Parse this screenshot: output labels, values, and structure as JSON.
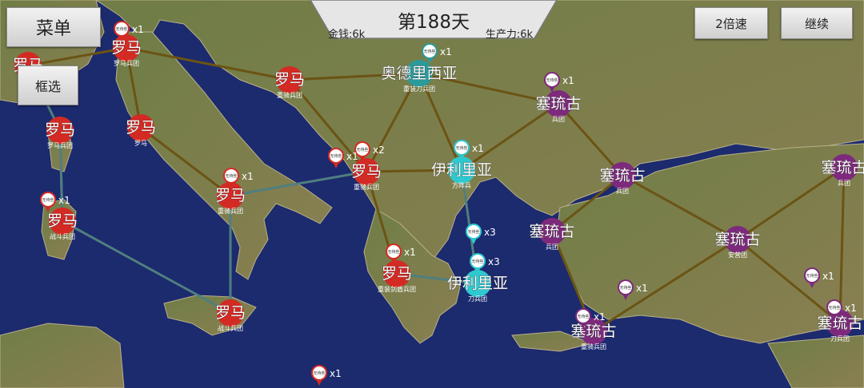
{
  "ui": {
    "menu_label": "菜单",
    "select_label": "框选",
    "day_label": "第188天",
    "money_label": "金钱:6k",
    "production_label": "生产力:6k",
    "speed_label": "2倍速",
    "continue_label": "继续"
  },
  "factions": {
    "rome": {
      "name": "罗马",
      "color": "#d42a24"
    },
    "illyria": {
      "name": "伊利里亚",
      "color": "#2ec8cf"
    },
    "sarmatia": {
      "name": "塞琉古",
      "color": "#7d2a7c"
    },
    "odrysia": {
      "name": "奥德里西亚",
      "color": "#2a9a9a"
    }
  },
  "nodes": [
    {
      "id": "rome-nw1",
      "faction": "rome",
      "name": "罗马",
      "sub": ""
    },
    {
      "id": "rome-n",
      "faction": "rome",
      "name": "罗马",
      "sub": "罗马兵团"
    },
    {
      "id": "rome-venice",
      "faction": "rome",
      "name": "罗马",
      "sub": "重骑兵团"
    },
    {
      "id": "rome-corsica",
      "faction": "rome",
      "name": "罗马",
      "sub": "罗马兵团"
    },
    {
      "id": "rome-center",
      "faction": "rome",
      "name": "罗马",
      "sub": "罗马"
    },
    {
      "id": "rome-naples",
      "faction": "rome",
      "name": "罗马",
      "sub": "重骑兵团"
    },
    {
      "id": "rome-sardinia",
      "faction": "rome",
      "name": "罗马",
      "sub": "战斗兵团"
    },
    {
      "id": "rome-albania",
      "faction": "rome",
      "name": "罗马",
      "sub": "重骑兵团"
    },
    {
      "id": "rome-greece",
      "faction": "rome",
      "name": "罗马",
      "sub": "重装剑盾兵团"
    },
    {
      "id": "rome-sicily",
      "faction": "rome",
      "name": "罗马",
      "sub": "战斗兵团"
    },
    {
      "id": "odrysia-main",
      "faction": "odrysia",
      "name": "奥德里西亚",
      "sub": "重装刀兵团"
    },
    {
      "id": "illyria-north",
      "faction": "illyria",
      "name": "伊利里亚",
      "sub": "方阵兵"
    },
    {
      "id": "illyria-south",
      "faction": "illyria",
      "name": "伊利里亚",
      "sub": "刀兵团"
    },
    {
      "id": "sel-thrace",
      "faction": "sarmatia",
      "name": "塞琉古",
      "sub": "兵团"
    },
    {
      "id": "sel-bosporus",
      "faction": "sarmatia",
      "name": "塞琉古",
      "sub": "兵团"
    },
    {
      "id": "sel-east",
      "faction": "sarmatia",
      "name": "塞琉古",
      "sub": "兵团"
    },
    {
      "id": "sel-ionia",
      "faction": "sarmatia",
      "name": "塞琉古",
      "sub": "兵团"
    },
    {
      "id": "sel-anatolia",
      "faction": "sarmatia",
      "name": "塞琉古",
      "sub": "安营团"
    },
    {
      "id": "sel-rhodes",
      "faction": "sarmatia",
      "name": "塞琉古",
      "sub": "重骑兵团"
    },
    {
      "id": "sel-syria",
      "faction": "sarmatia",
      "name": "塞琉古",
      "sub": "刀兵团"
    }
  ],
  "armies": [
    {
      "id": "a1",
      "label": "无待些",
      "count": "x1",
      "faction": "rome"
    },
    {
      "id": "a2",
      "label": "无待些",
      "count": "x1",
      "faction": "rome"
    },
    {
      "id": "a3",
      "label": "无待些",
      "count": "x1",
      "faction": "rome"
    },
    {
      "id": "a4",
      "label": "无待些",
      "count": "x2",
      "faction": "rome"
    },
    {
      "id": "a5",
      "label": "无待些",
      "count": "x1",
      "faction": "rome"
    },
    {
      "id": "a6",
      "label": "无待些",
      "count": "x1",
      "faction": "rome"
    },
    {
      "id": "a7",
      "label": "无待些",
      "count": "x1",
      "faction": "rome"
    },
    {
      "id": "a8",
      "label": "无待些",
      "count": "x1",
      "faction": "illyria"
    },
    {
      "id": "a9",
      "label": "无待些",
      "count": "x3",
      "faction": "illyria"
    },
    {
      "id": "a10",
      "label": "无待些",
      "count": "x3",
      "faction": "illyria"
    },
    {
      "id": "a11",
      "label": "无待些",
      "count": "x1",
      "faction": "odrysia"
    },
    {
      "id": "a12",
      "label": "无待些",
      "count": "x1",
      "faction": "sarmatia"
    },
    {
      "id": "a13",
      "label": "无待些",
      "count": "x1",
      "faction": "sarmatia"
    },
    {
      "id": "a14",
      "label": "无待些",
      "count": "x1",
      "faction": "sarmatia"
    },
    {
      "id": "a15",
      "label": "无待些",
      "count": "x1",
      "faction": "sarmatia"
    },
    {
      "id": "a16",
      "label": "无待些",
      "count": "x1",
      "faction": "sarmatia"
    },
    {
      "id": "a17",
      "label": "无待些",
      "count": "x1",
      "faction": "rome"
    }
  ],
  "edge_color": "#6b5414",
  "sea_edge_color": "#4f7f7f"
}
